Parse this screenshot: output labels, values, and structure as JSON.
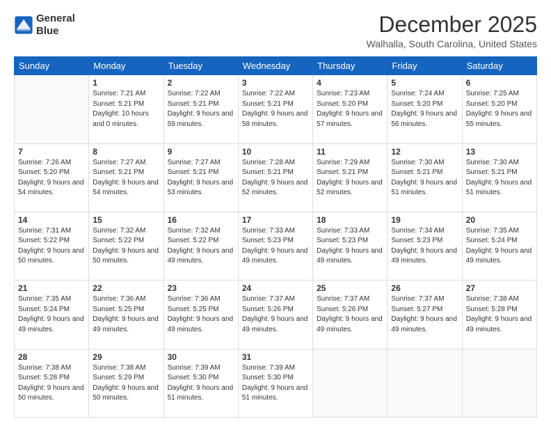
{
  "header": {
    "logo_line1": "General",
    "logo_line2": "Blue",
    "month": "December 2025",
    "location": "Walhalla, South Carolina, United States"
  },
  "days_of_week": [
    "Sunday",
    "Monday",
    "Tuesday",
    "Wednesday",
    "Thursday",
    "Friday",
    "Saturday"
  ],
  "weeks": [
    [
      {
        "num": "",
        "info": ""
      },
      {
        "num": "1",
        "info": "Sunrise: 7:21 AM\nSunset: 5:21 PM\nDaylight: 10 hours\nand 0 minutes."
      },
      {
        "num": "2",
        "info": "Sunrise: 7:22 AM\nSunset: 5:21 PM\nDaylight: 9 hours\nand 59 minutes."
      },
      {
        "num": "3",
        "info": "Sunrise: 7:22 AM\nSunset: 5:21 PM\nDaylight: 9 hours\nand 58 minutes."
      },
      {
        "num": "4",
        "info": "Sunrise: 7:23 AM\nSunset: 5:20 PM\nDaylight: 9 hours\nand 57 minutes."
      },
      {
        "num": "5",
        "info": "Sunrise: 7:24 AM\nSunset: 5:20 PM\nDaylight: 9 hours\nand 56 minutes."
      },
      {
        "num": "6",
        "info": "Sunrise: 7:25 AM\nSunset: 5:20 PM\nDaylight: 9 hours\nand 55 minutes."
      }
    ],
    [
      {
        "num": "7",
        "info": "Sunrise: 7:26 AM\nSunset: 5:20 PM\nDaylight: 9 hours\nand 54 minutes."
      },
      {
        "num": "8",
        "info": "Sunrise: 7:27 AM\nSunset: 5:21 PM\nDaylight: 9 hours\nand 54 minutes."
      },
      {
        "num": "9",
        "info": "Sunrise: 7:27 AM\nSunset: 5:21 PM\nDaylight: 9 hours\nand 53 minutes."
      },
      {
        "num": "10",
        "info": "Sunrise: 7:28 AM\nSunset: 5:21 PM\nDaylight: 9 hours\nand 52 minutes."
      },
      {
        "num": "11",
        "info": "Sunrise: 7:29 AM\nSunset: 5:21 PM\nDaylight: 9 hours\nand 52 minutes."
      },
      {
        "num": "12",
        "info": "Sunrise: 7:30 AM\nSunset: 5:21 PM\nDaylight: 9 hours\nand 51 minutes."
      },
      {
        "num": "13",
        "info": "Sunrise: 7:30 AM\nSunset: 5:21 PM\nDaylight: 9 hours\nand 51 minutes."
      }
    ],
    [
      {
        "num": "14",
        "info": "Sunrise: 7:31 AM\nSunset: 5:22 PM\nDaylight: 9 hours\nand 50 minutes."
      },
      {
        "num": "15",
        "info": "Sunrise: 7:32 AM\nSunset: 5:22 PM\nDaylight: 9 hours\nand 50 minutes."
      },
      {
        "num": "16",
        "info": "Sunrise: 7:32 AM\nSunset: 5:22 PM\nDaylight: 9 hours\nand 49 minutes."
      },
      {
        "num": "17",
        "info": "Sunrise: 7:33 AM\nSunset: 5:23 PM\nDaylight: 9 hours\nand 49 minutes."
      },
      {
        "num": "18",
        "info": "Sunrise: 7:33 AM\nSunset: 5:23 PM\nDaylight: 9 hours\nand 49 minutes."
      },
      {
        "num": "19",
        "info": "Sunrise: 7:34 AM\nSunset: 5:23 PM\nDaylight: 9 hours\nand 49 minutes."
      },
      {
        "num": "20",
        "info": "Sunrise: 7:35 AM\nSunset: 5:24 PM\nDaylight: 9 hours\nand 49 minutes."
      }
    ],
    [
      {
        "num": "21",
        "info": "Sunrise: 7:35 AM\nSunset: 5:24 PM\nDaylight: 9 hours\nand 49 minutes."
      },
      {
        "num": "22",
        "info": "Sunrise: 7:36 AM\nSunset: 5:25 PM\nDaylight: 9 hours\nand 49 minutes."
      },
      {
        "num": "23",
        "info": "Sunrise: 7:36 AM\nSunset: 5:25 PM\nDaylight: 9 hours\nand 49 minutes."
      },
      {
        "num": "24",
        "info": "Sunrise: 7:37 AM\nSunset: 5:26 PM\nDaylight: 9 hours\nand 49 minutes."
      },
      {
        "num": "25",
        "info": "Sunrise: 7:37 AM\nSunset: 5:26 PM\nDaylight: 9 hours\nand 49 minutes."
      },
      {
        "num": "26",
        "info": "Sunrise: 7:37 AM\nSunset: 5:27 PM\nDaylight: 9 hours\nand 49 minutes."
      },
      {
        "num": "27",
        "info": "Sunrise: 7:38 AM\nSunset: 5:28 PM\nDaylight: 9 hours\nand 49 minutes."
      }
    ],
    [
      {
        "num": "28",
        "info": "Sunrise: 7:38 AM\nSunset: 5:28 PM\nDaylight: 9 hours\nand 50 minutes."
      },
      {
        "num": "29",
        "info": "Sunrise: 7:38 AM\nSunset: 5:29 PM\nDaylight: 9 hours\nand 50 minutes."
      },
      {
        "num": "30",
        "info": "Sunrise: 7:39 AM\nSunset: 5:30 PM\nDaylight: 9 hours\nand 51 minutes."
      },
      {
        "num": "31",
        "info": "Sunrise: 7:39 AM\nSunset: 5:30 PM\nDaylight: 9 hours\nand 51 minutes."
      },
      {
        "num": "",
        "info": ""
      },
      {
        "num": "",
        "info": ""
      },
      {
        "num": "",
        "info": ""
      }
    ]
  ]
}
